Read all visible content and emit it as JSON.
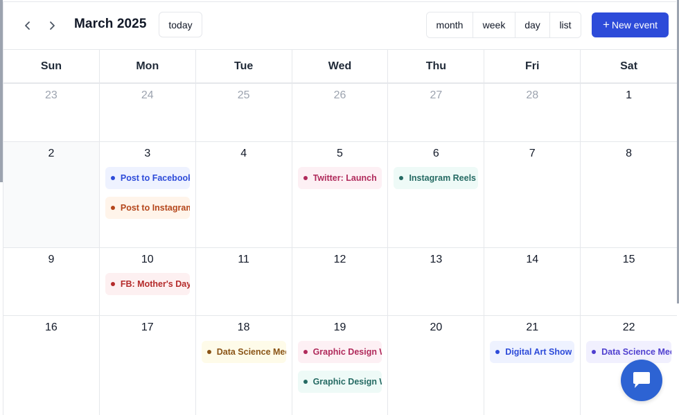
{
  "toolbar": {
    "prev_icon": "chevron-left-icon",
    "next_icon": "chevron-right-icon",
    "title": "March 2025",
    "today_label": "today",
    "views": [
      {
        "label": "month",
        "width": 67
      },
      {
        "label": "week",
        "width": 61
      },
      {
        "label": "day",
        "width": 50
      },
      {
        "label": "list",
        "width": 44
      }
    ],
    "new_event_label": "New event",
    "new_event_icon": "plus-icon",
    "accent": "#2d4bd9"
  },
  "weekdays": [
    "Sun",
    "Mon",
    "Tue",
    "Wed",
    "Thu",
    "Fri",
    "Sat"
  ],
  "weeks": [
    {
      "height": 84,
      "days": [
        {
          "num": "23",
          "muted": true,
          "events": []
        },
        {
          "num": "24",
          "muted": true,
          "events": []
        },
        {
          "num": "25",
          "muted": true,
          "events": []
        },
        {
          "num": "26",
          "muted": true,
          "events": []
        },
        {
          "num": "27",
          "muted": true,
          "events": []
        },
        {
          "num": "28",
          "muted": true,
          "events": []
        },
        {
          "num": "1",
          "muted": false,
          "events": []
        }
      ]
    },
    {
      "height": 153,
      "days": [
        {
          "num": "2",
          "muted": false,
          "shaded": true,
          "events": []
        },
        {
          "num": "3",
          "muted": false,
          "events": [
            {
              "title": "Post to Facebook",
              "bg": "#eef2ff",
              "fg": "#2d4bd9",
              "dot": "#2d4bd9"
            },
            {
              "title": "Post to Instagram",
              "bg": "#fff4ea",
              "fg": "#b4461b",
              "dot": "#b4461b"
            }
          ]
        },
        {
          "num": "4",
          "muted": false,
          "events": []
        },
        {
          "num": "5",
          "muted": false,
          "events": [
            {
              "title": "Twitter: Launch",
              "bg": "#fdf0f4",
              "fg": "#b02a5b",
              "dot": "#b02a5b"
            }
          ]
        },
        {
          "num": "6",
          "muted": false,
          "events": [
            {
              "title": "Instagram Reels",
              "bg": "#eefaf7",
              "fg": "#256a63",
              "dot": "#256a63"
            }
          ]
        },
        {
          "num": "7",
          "muted": false,
          "events": []
        },
        {
          "num": "8",
          "muted": false,
          "events": []
        }
      ]
    },
    {
      "height": 98,
      "days": [
        {
          "num": "9",
          "muted": false,
          "events": []
        },
        {
          "num": "10",
          "muted": false,
          "events": [
            {
              "title": "FB: Mother's Day",
              "bg": "#fdf0f1",
              "fg": "#b42a2a",
              "dot": "#b42a2a"
            }
          ]
        },
        {
          "num": "11",
          "muted": false,
          "events": []
        },
        {
          "num": "12",
          "muted": false,
          "events": []
        },
        {
          "num": "13",
          "muted": false,
          "events": []
        },
        {
          "num": "14",
          "muted": false,
          "events": []
        },
        {
          "num": "15",
          "muted": false,
          "events": []
        }
      ]
    },
    {
      "height": 145,
      "days": [
        {
          "num": "16",
          "muted": false,
          "events": []
        },
        {
          "num": "17",
          "muted": false,
          "events": []
        },
        {
          "num": "18",
          "muted": false,
          "events": [
            {
              "title": "Data Science Meetup",
              "bg": "#fefbe9",
              "fg": "#8a5416",
              "dot": "#8a5416"
            }
          ]
        },
        {
          "num": "19",
          "muted": false,
          "events": [
            {
              "title": "Graphic Design Workshop",
              "bg": "#fdf0f4",
              "fg": "#b02a5b",
              "dot": "#b02a5b"
            },
            {
              "title": "Graphic Design Webinar",
              "bg": "#eefaf7",
              "fg": "#256a63",
              "dot": "#256a63"
            }
          ]
        },
        {
          "num": "20",
          "muted": false,
          "events": []
        },
        {
          "num": "21",
          "muted": false,
          "events": [
            {
              "title": "Digital Art Show",
              "bg": "#eef2ff",
              "fg": "#2d4bd9",
              "dot": "#2d4bd9"
            }
          ]
        },
        {
          "num": "22",
          "muted": false,
          "events": [
            {
              "title": "Data Science Meetup",
              "bg": "#f1f0fe",
              "fg": "#4f3fcf",
              "dot": "#4f3fcf"
            }
          ]
        }
      ]
    }
  ],
  "chat": {
    "icon": "chat-bubble-icon",
    "color": "#2d63d3"
  }
}
